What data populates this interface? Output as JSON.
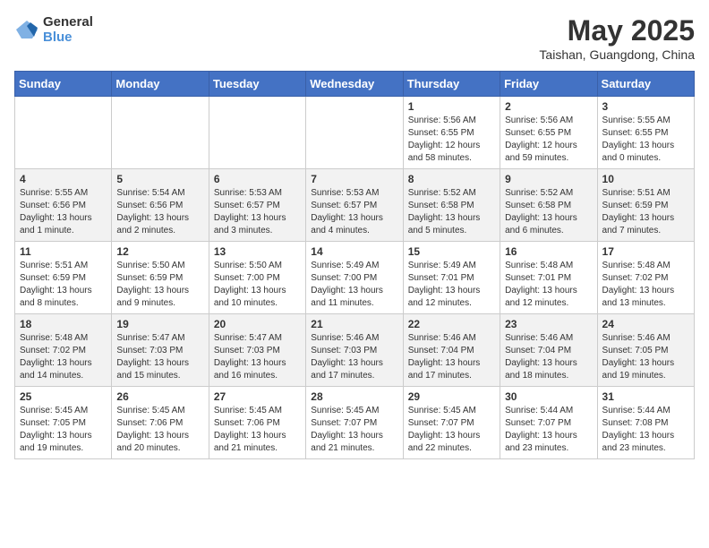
{
  "header": {
    "logo_general": "General",
    "logo_blue": "Blue",
    "month_year": "May 2025",
    "location": "Taishan, Guangdong, China"
  },
  "weekdays": [
    "Sunday",
    "Monday",
    "Tuesday",
    "Wednesday",
    "Thursday",
    "Friday",
    "Saturday"
  ],
  "weeks": [
    [
      {
        "day": "",
        "info": ""
      },
      {
        "day": "",
        "info": ""
      },
      {
        "day": "",
        "info": ""
      },
      {
        "day": "",
        "info": ""
      },
      {
        "day": "1",
        "info": "Sunrise: 5:56 AM\nSunset: 6:55 PM\nDaylight: 12 hours and 58 minutes."
      },
      {
        "day": "2",
        "info": "Sunrise: 5:56 AM\nSunset: 6:55 PM\nDaylight: 12 hours and 59 minutes."
      },
      {
        "day": "3",
        "info": "Sunrise: 5:55 AM\nSunset: 6:55 PM\nDaylight: 13 hours and 0 minutes."
      }
    ],
    [
      {
        "day": "4",
        "info": "Sunrise: 5:55 AM\nSunset: 6:56 PM\nDaylight: 13 hours and 1 minute."
      },
      {
        "day": "5",
        "info": "Sunrise: 5:54 AM\nSunset: 6:56 PM\nDaylight: 13 hours and 2 minutes."
      },
      {
        "day": "6",
        "info": "Sunrise: 5:53 AM\nSunset: 6:57 PM\nDaylight: 13 hours and 3 minutes."
      },
      {
        "day": "7",
        "info": "Sunrise: 5:53 AM\nSunset: 6:57 PM\nDaylight: 13 hours and 4 minutes."
      },
      {
        "day": "8",
        "info": "Sunrise: 5:52 AM\nSunset: 6:58 PM\nDaylight: 13 hours and 5 minutes."
      },
      {
        "day": "9",
        "info": "Sunrise: 5:52 AM\nSunset: 6:58 PM\nDaylight: 13 hours and 6 minutes."
      },
      {
        "day": "10",
        "info": "Sunrise: 5:51 AM\nSunset: 6:59 PM\nDaylight: 13 hours and 7 minutes."
      }
    ],
    [
      {
        "day": "11",
        "info": "Sunrise: 5:51 AM\nSunset: 6:59 PM\nDaylight: 13 hours and 8 minutes."
      },
      {
        "day": "12",
        "info": "Sunrise: 5:50 AM\nSunset: 6:59 PM\nDaylight: 13 hours and 9 minutes."
      },
      {
        "day": "13",
        "info": "Sunrise: 5:50 AM\nSunset: 7:00 PM\nDaylight: 13 hours and 10 minutes."
      },
      {
        "day": "14",
        "info": "Sunrise: 5:49 AM\nSunset: 7:00 PM\nDaylight: 13 hours and 11 minutes."
      },
      {
        "day": "15",
        "info": "Sunrise: 5:49 AM\nSunset: 7:01 PM\nDaylight: 13 hours and 12 minutes."
      },
      {
        "day": "16",
        "info": "Sunrise: 5:48 AM\nSunset: 7:01 PM\nDaylight: 13 hours and 12 minutes."
      },
      {
        "day": "17",
        "info": "Sunrise: 5:48 AM\nSunset: 7:02 PM\nDaylight: 13 hours and 13 minutes."
      }
    ],
    [
      {
        "day": "18",
        "info": "Sunrise: 5:48 AM\nSunset: 7:02 PM\nDaylight: 13 hours and 14 minutes."
      },
      {
        "day": "19",
        "info": "Sunrise: 5:47 AM\nSunset: 7:03 PM\nDaylight: 13 hours and 15 minutes."
      },
      {
        "day": "20",
        "info": "Sunrise: 5:47 AM\nSunset: 7:03 PM\nDaylight: 13 hours and 16 minutes."
      },
      {
        "day": "21",
        "info": "Sunrise: 5:46 AM\nSunset: 7:03 PM\nDaylight: 13 hours and 17 minutes."
      },
      {
        "day": "22",
        "info": "Sunrise: 5:46 AM\nSunset: 7:04 PM\nDaylight: 13 hours and 17 minutes."
      },
      {
        "day": "23",
        "info": "Sunrise: 5:46 AM\nSunset: 7:04 PM\nDaylight: 13 hours and 18 minutes."
      },
      {
        "day": "24",
        "info": "Sunrise: 5:46 AM\nSunset: 7:05 PM\nDaylight: 13 hours and 19 minutes."
      }
    ],
    [
      {
        "day": "25",
        "info": "Sunrise: 5:45 AM\nSunset: 7:05 PM\nDaylight: 13 hours and 19 minutes."
      },
      {
        "day": "26",
        "info": "Sunrise: 5:45 AM\nSunset: 7:06 PM\nDaylight: 13 hours and 20 minutes."
      },
      {
        "day": "27",
        "info": "Sunrise: 5:45 AM\nSunset: 7:06 PM\nDaylight: 13 hours and 21 minutes."
      },
      {
        "day": "28",
        "info": "Sunrise: 5:45 AM\nSunset: 7:07 PM\nDaylight: 13 hours and 21 minutes."
      },
      {
        "day": "29",
        "info": "Sunrise: 5:45 AM\nSunset: 7:07 PM\nDaylight: 13 hours and 22 minutes."
      },
      {
        "day": "30",
        "info": "Sunrise: 5:44 AM\nSunset: 7:07 PM\nDaylight: 13 hours and 23 minutes."
      },
      {
        "day": "31",
        "info": "Sunrise: 5:44 AM\nSunset: 7:08 PM\nDaylight: 13 hours and 23 minutes."
      }
    ]
  ]
}
